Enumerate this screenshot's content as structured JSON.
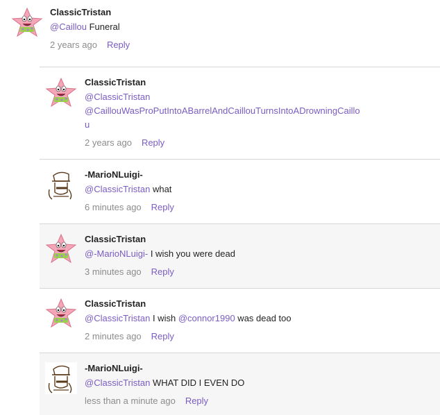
{
  "comments": [
    {
      "author": "ClassicTristan",
      "mention": "@Caillou",
      "text": " Funeral",
      "time": "2 years ago",
      "reply": "Reply"
    },
    {
      "author": "ClassicTristan",
      "mention": "@ClassicTristan",
      "mention2": "@CaillouWasProPutIntoABarrelAndCaillouTurnsIntoADrowningCaillou",
      "text": "",
      "time": "2 years ago",
      "reply": "Reply"
    },
    {
      "author": "-MarioNLuigi-",
      "mention": "@ClassicTristan",
      "text": " what",
      "time": "6 minutes ago",
      "reply": "Reply"
    },
    {
      "author": "ClassicTristan",
      "mention": "@-MarioNLuigi-",
      "text": " I wish you were dead",
      "time": "3 minutes ago",
      "reply": "Reply"
    },
    {
      "author": "ClassicTristan",
      "mention": "@ClassicTristan",
      "text": " I wish ",
      "mention3": "@connor1990",
      "text2": " was dead too",
      "time": "2 minutes ago",
      "reply": "Reply"
    },
    {
      "author": "-MarioNLuigi-",
      "mention": "@ClassicTristan",
      "text": " WHAT DID I EVEN DO",
      "time": "less than a minute ago",
      "reply": "Reply"
    }
  ],
  "icons": {
    "patrick": "patrick-star-avatar",
    "mario": "mario-sketch-avatar"
  },
  "colors": {
    "link": "#7a5cc2",
    "meta": "#8c8c8c",
    "divider": "#d6d6d6",
    "shade": "#f6f6f6"
  }
}
